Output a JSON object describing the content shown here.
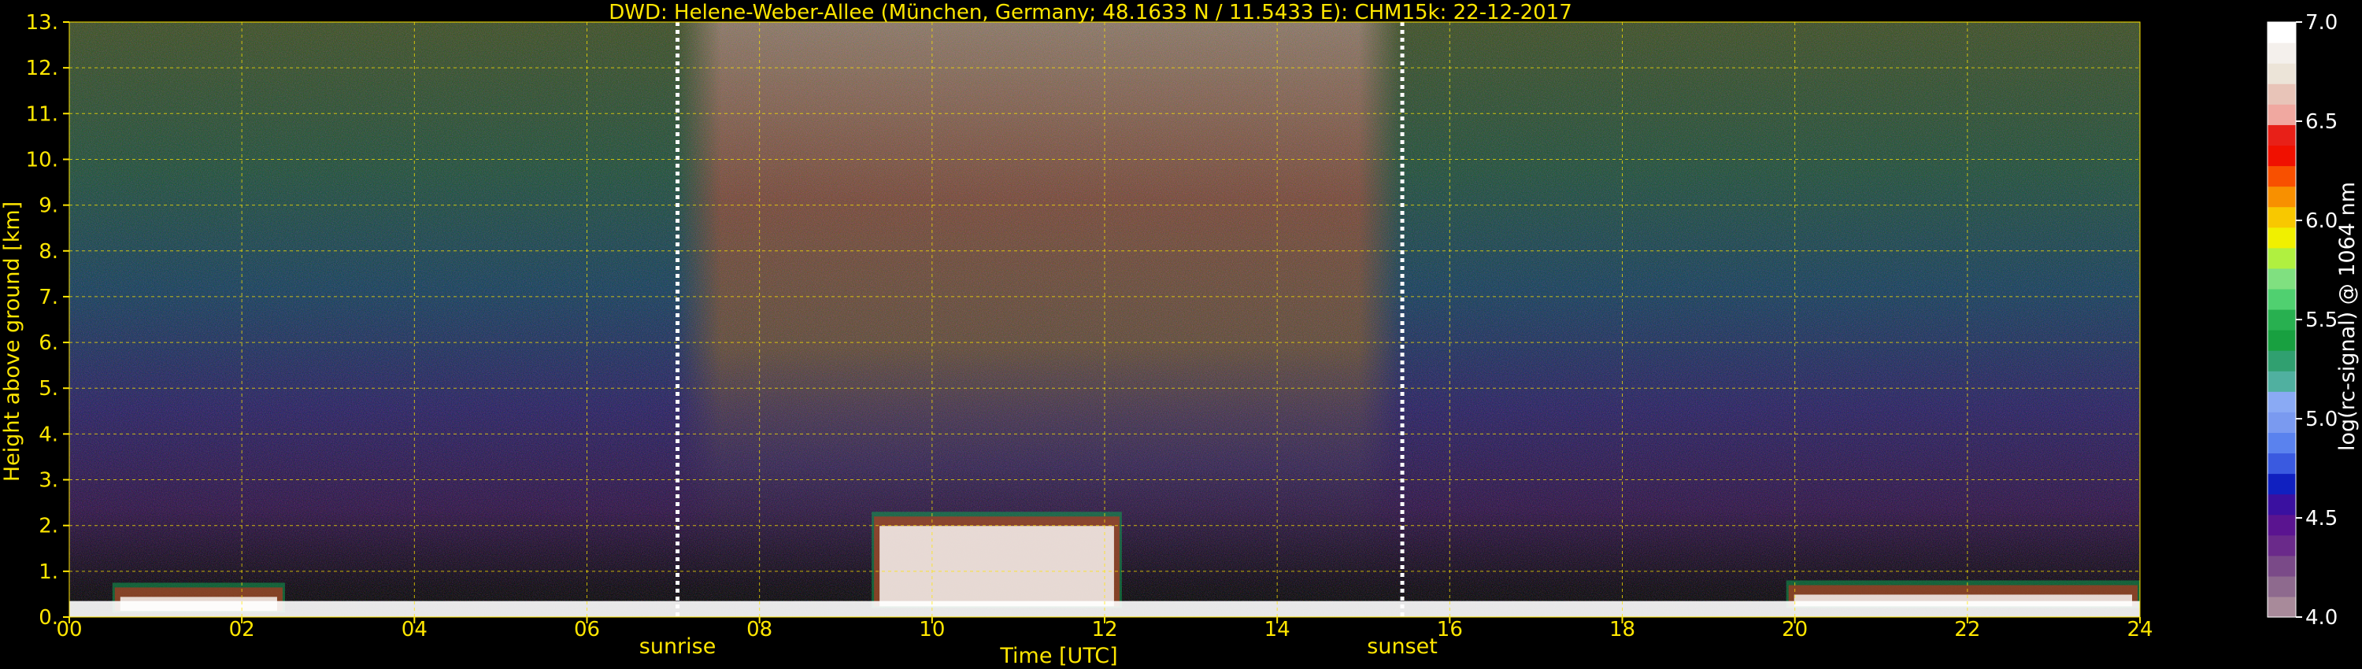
{
  "chart_data": {
    "type": "heatmap",
    "title": "DWD: Helene-Weber-Allee (München, Germany; 48.1633 N / 11.5433 E):    CHM15k: 22-12-2017",
    "xlabel": "Time [UTC]",
    "ylabel": "Height above ground [km]",
    "xlim": [
      0,
      24
    ],
    "ylim": [
      0,
      13
    ],
    "x_ticks": [
      0,
      2,
      4,
      6,
      8,
      10,
      12,
      14,
      16,
      18,
      20,
      22,
      24
    ],
    "x_tick_labels": [
      "00",
      "02",
      "04",
      "06",
      "08",
      "10",
      "12",
      "14",
      "16",
      "18",
      "20",
      "22",
      "24"
    ],
    "y_ticks": [
      0,
      1,
      2,
      3,
      4,
      5,
      6,
      7,
      8,
      9,
      10,
      11,
      12,
      13
    ],
    "y_tick_labels": [
      "0.",
      "1.",
      "2.",
      "3.",
      "4.",
      "5.",
      "6.",
      "7.",
      "8.",
      "9.",
      "10.",
      "11.",
      "12.",
      "13."
    ],
    "grid": true,
    "annotations": [
      {
        "label": "sunrise",
        "x": 7.05
      },
      {
        "label": "sunset",
        "x": 15.45
      }
    ],
    "colorbar": {
      "label": "log(rc-signal) @ 1064 nm",
      "range": [
        4.0,
        7.0
      ],
      "ticks": [
        4.0,
        4.5,
        5.0,
        5.5,
        6.0,
        6.5,
        7.0
      ],
      "tick_labels": [
        "4.0",
        "4.5",
        "5.0",
        "5.5",
        "6.0",
        "6.5",
        "7.0"
      ],
      "colors": [
        "#a88a9a",
        "#8e6a8e",
        "#7a4a88",
        "#6a2a8a",
        "#5a1490",
        "#3a10a0",
        "#1020c0",
        "#3a5ae0",
        "#5a82ee",
        "#7a9af0",
        "#8aaaf4",
        "#50b0a0",
        "#30a070",
        "#18a040",
        "#28b050",
        "#50d070",
        "#80e080",
        "#b0f040",
        "#f0f000",
        "#f8c800",
        "#f89000",
        "#f85000",
        "#f01000",
        "#e82018",
        "#f0a8a0",
        "#e8c4b8",
        "#ece4d8",
        "#f4f0ec",
        "#ffffff"
      ]
    },
    "cloud_layers": [
      {
        "x_start": 9.3,
        "x_end": 12.2,
        "base_km": 0.2,
        "top_km": 2.3
      },
      {
        "x_start": 19.9,
        "x_end": 24.0,
        "base_km": 0.2,
        "top_km": 0.8
      },
      {
        "x_start": 0.5,
        "x_end": 2.5,
        "base_km": 0.1,
        "top_km": 0.75
      }
    ]
  }
}
